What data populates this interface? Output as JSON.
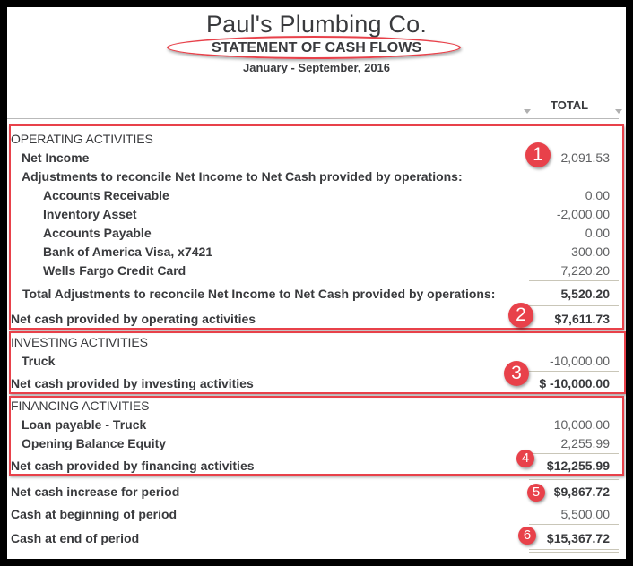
{
  "report": {
    "company": "Paul's Plumbing Co.",
    "title": "STATEMENT OF CASH FLOWS",
    "period": "January - September, 2016",
    "column_header": "TOTAL"
  },
  "operating": {
    "header": "OPERATING ACTIVITIES",
    "net_income": {
      "label": "Net Income",
      "value": "2,091.53"
    },
    "adjustments_label": "Adjustments to reconcile Net Income to Net Cash provided by operations:",
    "items": [
      {
        "label": "Accounts Receivable",
        "value": "0.00"
      },
      {
        "label": "Inventory Asset",
        "value": "-2,000.00"
      },
      {
        "label": "Accounts Payable",
        "value": "0.00"
      },
      {
        "label": "Bank of America Visa, x7421",
        "value": "300.00"
      },
      {
        "label": "Wells Fargo Credit Card",
        "value": "7,220.20"
      }
    ],
    "total_adjustments": {
      "label": "Total Adjustments to reconcile Net Income to Net Cash provided by operations:",
      "value": "5,520.20"
    },
    "net": {
      "label": "Net cash provided by operating activities",
      "value": "$7,611.73"
    }
  },
  "investing": {
    "header": "INVESTING ACTIVITIES",
    "items": [
      {
        "label": "Truck",
        "value": "-10,000.00"
      }
    ],
    "net": {
      "label": "Net cash provided by investing activities",
      "value": "$ -10,000.00"
    }
  },
  "financing": {
    "header": "FINANCING ACTIVITIES",
    "items": [
      {
        "label": "Loan payable - Truck",
        "value": "10,000.00"
      },
      {
        "label": "Opening Balance Equity",
        "value": "2,255.99"
      }
    ],
    "net": {
      "label": "Net cash provided by financing activities",
      "value": "$12,255.99"
    }
  },
  "summary": {
    "increase": {
      "label": "Net cash increase for period",
      "value": "$9,867.72"
    },
    "beginning": {
      "label": "Cash at beginning of period",
      "value": "5,500.00"
    },
    "end": {
      "label": "Cash at end of period",
      "value": "$15,367.72"
    }
  },
  "annotations": {
    "badges": [
      "1",
      "2",
      "3",
      "4",
      "5",
      "6"
    ],
    "color": "#e8414a"
  }
}
